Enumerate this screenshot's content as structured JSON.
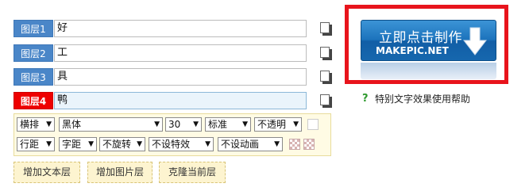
{
  "layers": [
    {
      "label": "图层1",
      "text": "好",
      "active": false
    },
    {
      "label": "图层2",
      "text": "工",
      "active": false
    },
    {
      "label": "图层3",
      "text": "具",
      "active": false
    },
    {
      "label": "图层4",
      "text": "鸭",
      "active": true
    }
  ],
  "toolbar": {
    "row1": {
      "direction": "横排",
      "font": "黑体",
      "size": "30",
      "style": "标准",
      "opacity": "不透明"
    },
    "row2": {
      "line_spacing": "行距",
      "letter_spacing": "字距",
      "rotate": "不旋转",
      "effect": "不设特效",
      "animation": "不设动画"
    }
  },
  "actions": {
    "add_text": "增加文本层",
    "add_image": "增加图片层",
    "clone": "克隆当前层"
  },
  "make_button": {
    "title": "立即点击制作",
    "subtitle": "MAKEPIC.NET"
  },
  "help": {
    "text": "特别文字效果使用帮助",
    "icon": "question-icon"
  },
  "colors": {
    "layer_label": "#4a86c8",
    "active_layer_label": "#ee0000",
    "highlight_frame": "#e8141c",
    "make_button": "#1c73bc"
  }
}
